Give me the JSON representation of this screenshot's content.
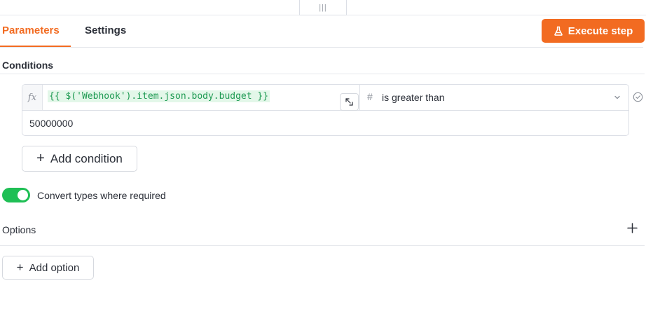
{
  "drag_handle": {
    "glyph": "|||"
  },
  "tabs": [
    {
      "label": "Parameters",
      "active": true
    },
    {
      "label": "Settings",
      "active": false
    }
  ],
  "toolbar": {
    "execute_label": "Execute step",
    "execute_icon": "flask-icon"
  },
  "conditions": {
    "title": "Conditions",
    "items": [
      {
        "fx_label": "fx",
        "left_value": "{{ $('Webhook').item.json.body.budget }}",
        "operator_type_icon": "#",
        "operator": "is greater than",
        "right_value": "50000000"
      }
    ],
    "add_label": "Add condition"
  },
  "convert_types": {
    "label": "Convert types where required",
    "enabled": true
  },
  "options": {
    "title": "Options",
    "add_label": "Add option"
  },
  "colors": {
    "accent": "#f26b21",
    "toggle_on": "#1fbf55",
    "expression": "#1e9a52"
  }
}
